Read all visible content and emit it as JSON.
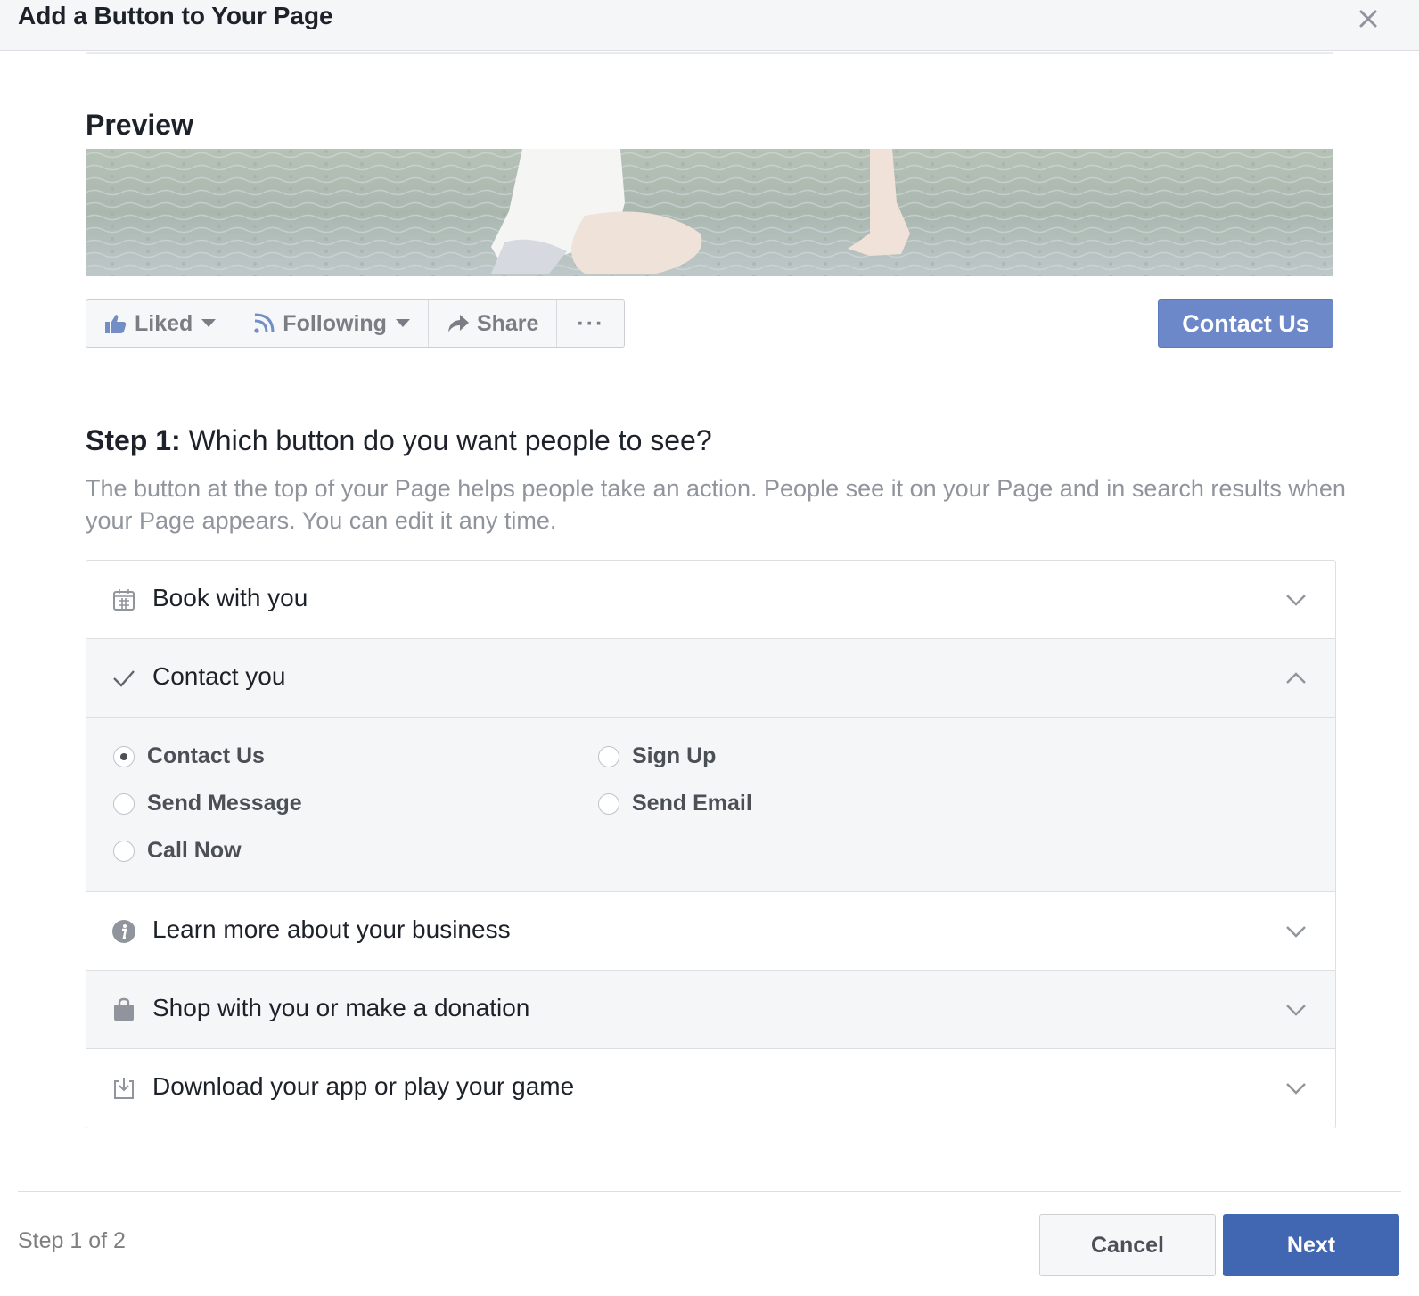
{
  "dialog": {
    "title": "Add a Button to Your Page"
  },
  "preview": {
    "heading": "Preview",
    "actions": [
      {
        "label": "Liked",
        "icon": "thumbs-up-icon"
      },
      {
        "label": "Following",
        "icon": "rss-icon"
      },
      {
        "label": "Share",
        "icon": "share-arrow-icon"
      },
      {
        "label": "···",
        "icon": "more-icon"
      }
    ],
    "cta_button": "Contact Us"
  },
  "step": {
    "title_bold": "Step 1:",
    "title_rest": " Which button do you want people to see?",
    "description": "The button at the top of your Page helps people take an action. People see it on your Page and in search results when your Page appears. You can edit it any time."
  },
  "options": [
    {
      "label": "Book with you",
      "icon": "calendar-icon",
      "expanded": false
    },
    {
      "label": "Contact you",
      "icon": "checkmark-icon",
      "expanded": true
    },
    {
      "label": "Learn more about your business",
      "icon": "info-icon",
      "expanded": false
    },
    {
      "label": "Shop with you or make a donation",
      "icon": "shopping-bag-icon",
      "expanded": false
    },
    {
      "label": "Download your app or play your game",
      "icon": "download-icon",
      "expanded": false
    }
  ],
  "contact_choices": {
    "selected": "Contact Us",
    "left": [
      "Contact Us",
      "Send Message",
      "Call Now"
    ],
    "right": [
      "Sign Up",
      "Send Email"
    ]
  },
  "footer": {
    "step_count": "Step 1 of 2",
    "cancel": "Cancel",
    "next": "Next"
  },
  "colors": {
    "primary": "#4267b2",
    "cta_light": "#6d88c8",
    "muted_text": "#90949c",
    "panel_grey": "#f5f6f7",
    "border": "#dddfe2"
  }
}
